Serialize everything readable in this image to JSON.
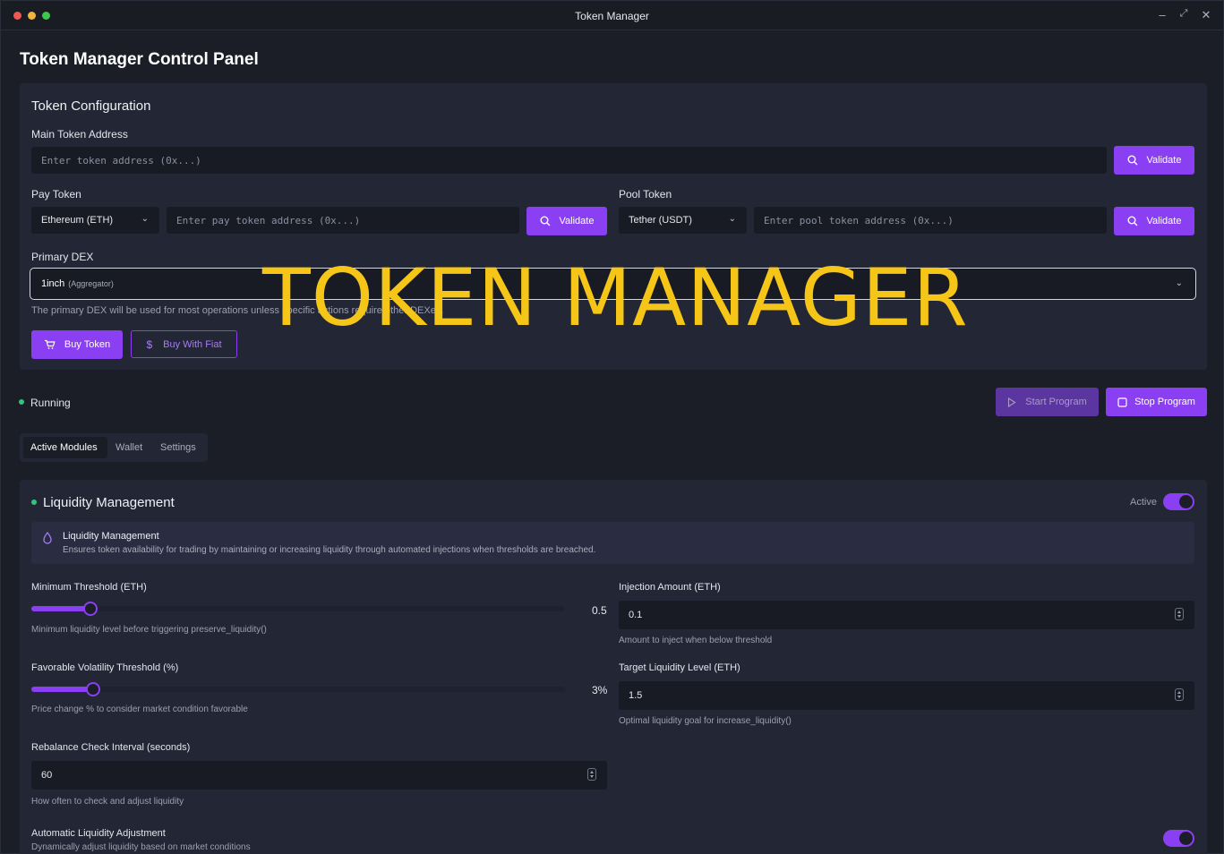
{
  "window": {
    "title": "Token Manager",
    "controls": [
      "–",
      "⤢",
      "✕"
    ]
  },
  "page": {
    "title": "Token Manager Control Panel"
  },
  "watermark": "TOKEN MANAGER",
  "token_config": {
    "title": "Token Configuration",
    "main_token": {
      "label": "Main Token Address",
      "placeholder": "Enter token address (0x...)",
      "validate_label": "Validate"
    },
    "pay_token": {
      "label": "Pay Token",
      "selected": "Ethereum (ETH)",
      "placeholder": "Enter pay token address (0x...)",
      "validate_label": "Validate"
    },
    "pool_token": {
      "label": "Pool Token",
      "selected": "Tether (USDT)",
      "placeholder": "Enter pool token address (0x...)",
      "validate_label": "Validate"
    },
    "primary_dex": {
      "label": "Primary DEX",
      "selected": "1inch",
      "selected_sub": "(Aggregator)",
      "hint": "The primary DEX will be used for most operations unless specific actions require other DEXes."
    },
    "buy_token_label": "Buy Token",
    "buy_fiat_label": "Buy With Fiat"
  },
  "status": {
    "text": "Running",
    "start_label": "Start Program",
    "stop_label": "Stop Program"
  },
  "tabs": [
    {
      "label": "Active Modules",
      "active": true
    },
    {
      "label": "Wallet",
      "active": false
    },
    {
      "label": "Settings",
      "active": false
    }
  ],
  "liquidity": {
    "title": "Liquidity Management",
    "active_label": "Active",
    "active": true,
    "info_title": "Liquidity Management",
    "info_desc": "Ensures token availability for trading by maintaining or increasing liquidity through automated injections when thresholds are breached.",
    "min_threshold": {
      "label": "Minimum Threshold (ETH)",
      "value_text": "0.5",
      "fraction": 0.11,
      "hint": "Minimum liquidity level before triggering preserve_liquidity()"
    },
    "volatility": {
      "label": "Favorable Volatility Threshold (%)",
      "value_text": "3%",
      "fraction": 0.115,
      "hint": "Price change % to consider market condition favorable"
    },
    "injection": {
      "label": "Injection Amount (ETH)",
      "value": "0.1",
      "hint": "Amount to inject when below threshold"
    },
    "target": {
      "label": "Target Liquidity Level (ETH)",
      "value": "1.5",
      "hint": "Optimal liquidity goal for increase_liquidity()"
    },
    "rebalance": {
      "label": "Rebalance Check Interval (seconds)",
      "value": "60",
      "hint": "How often to check and adjust liquidity"
    },
    "auto_adjust": {
      "label": "Automatic Liquidity Adjustment",
      "hint": "Dynamically adjust liquidity based on market conditions",
      "enabled": true
    }
  },
  "colors": {
    "accent": "#8a3ff2",
    "background": "#1b1e27",
    "card": "#232735",
    "status_green": "#2ec77b",
    "watermark": "#f5c518"
  }
}
